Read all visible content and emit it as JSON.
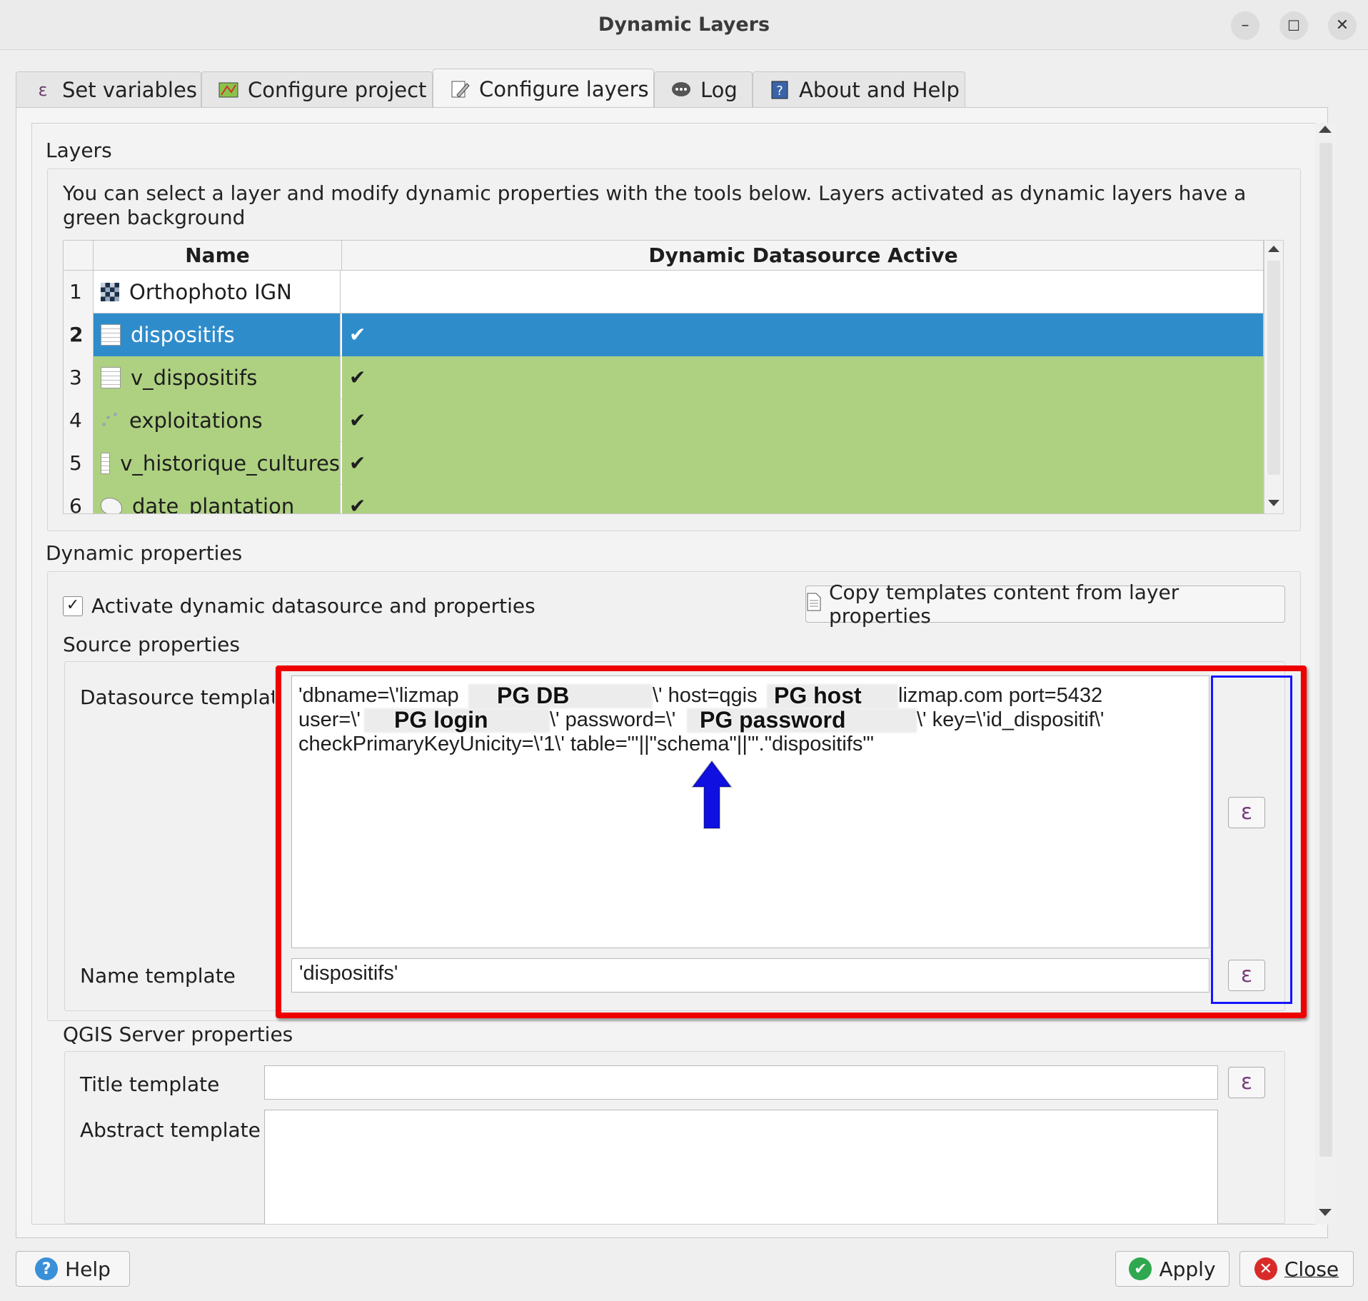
{
  "window": {
    "title": "Dynamic Layers",
    "minimize": "–",
    "maximize": "☐",
    "close": "✕"
  },
  "tabs": [
    {
      "label": "Set variables",
      "icon": "epsilon-icon"
    },
    {
      "label": "Configure project",
      "icon": "map-icon"
    },
    {
      "label": "Configure layers",
      "icon": "edit-layer-icon",
      "active": true
    },
    {
      "label": "Log",
      "icon": "chat-icon"
    },
    {
      "label": "About and Help",
      "icon": "help-book-icon"
    }
  ],
  "layers": {
    "section_title": "Layers",
    "info": "You can select a layer and modify dynamic properties with the tools below. Layers activated as dynamic layers have a green background",
    "columns": [
      "Name",
      "Dynamic Datasource Active"
    ],
    "rows": [
      {
        "num": "1",
        "name": "Orthophoto IGN",
        "active": "",
        "type": "raster",
        "state": "plain"
      },
      {
        "num": "2",
        "name": "dispositifs",
        "active": "✔",
        "type": "table",
        "state": "selected"
      },
      {
        "num": "3",
        "name": "v_dispositifs",
        "active": "✔",
        "type": "table",
        "state": "green"
      },
      {
        "num": "4",
        "name": "exploitations",
        "active": "✔",
        "type": "point",
        "state": "green"
      },
      {
        "num": "5",
        "name": "v_historique_cultures",
        "active": "✔",
        "type": "table",
        "state": "green"
      },
      {
        "num": "6",
        "name": "date_plantation",
        "active": "✔",
        "type": "polygon",
        "state": "green"
      }
    ]
  },
  "dynamic": {
    "section_title": "Dynamic properties",
    "activate_label": "Activate dynamic datasource and properties",
    "activate_checked": "✓",
    "copy_button": "Copy templates content from layer properties",
    "source_title": "Source properties",
    "datasource_label": "Datasource template",
    "datasource_lines": [
      "'dbname=\\'lizmap",
      "\\' host=qgis",
      "lizmap.com port=5432",
      "user=\\'",
      "\\' password=\\'",
      "\\' key=\\'id_dispositif\\'",
      "checkPrimaryKeyUnicity=\\'1\\' table=\"'||\"schema\"||'\".\"dispositifs\"'"
    ],
    "redactions": [
      "PG DB",
      "PG host",
      "PG login",
      "PG password"
    ],
    "name_label": "Name template",
    "name_value": "'dispositifs'",
    "epsilon": "ε"
  },
  "server": {
    "section_title": "QGIS Server properties",
    "title_label": "Title template",
    "title_value": "",
    "abstract_label": "Abstract template",
    "abstract_value": ""
  },
  "buttons": {
    "help": "Help",
    "apply": "Apply",
    "close": "Close"
  },
  "colors": {
    "selected": "#2f8ccb",
    "dynamic_green": "#aed181",
    "annotation_red": "#ee0000",
    "annotation_blue": "#1515ff"
  }
}
